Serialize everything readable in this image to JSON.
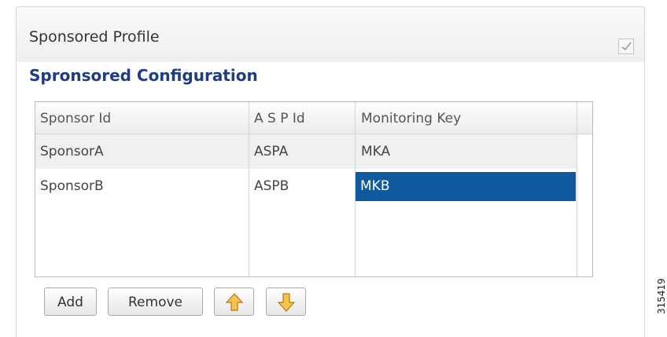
{
  "panel": {
    "title": "Sponsored Profile"
  },
  "section": {
    "title": "Spronsored Configuration"
  },
  "table": {
    "columns": [
      "Sponsor Id",
      "A S P Id",
      "Monitoring Key"
    ],
    "rows": [
      [
        "SponsorA",
        "ASPA",
        "MKA"
      ],
      [
        "SponsorB",
        "ASPB",
        "MKB"
      ]
    ],
    "selected_row": 1,
    "selected_column": 2
  },
  "buttons": {
    "add": "Add",
    "remove": "Remove",
    "up_icon": "arrow-up-icon",
    "down_icon": "arrow-down-icon"
  },
  "figure_id": "315419",
  "colors": {
    "section_title": "#1f3c84",
    "selection": "#0f5a9e",
    "arrow_fill": "#f7c34a"
  }
}
